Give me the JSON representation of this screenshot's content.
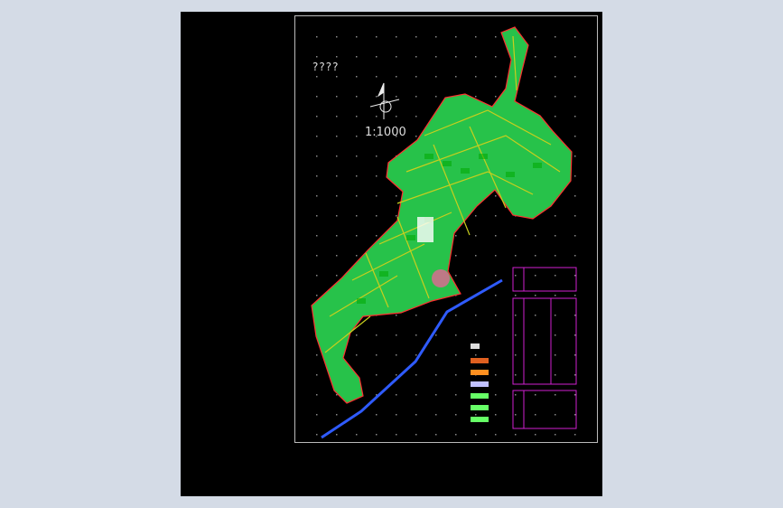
{
  "drawing": {
    "title": "????",
    "scale_label": "1:1000"
  },
  "colors": {
    "background": "#d4dbe6",
    "canvas": "#000000",
    "site": "#27c24a",
    "road": "#c8cf1e",
    "boundary": "#ff3030",
    "highway": "#2f5bff",
    "table_line": "#d020d0",
    "text": "#dddddd"
  },
  "icons": [
    "north-arrow-icon"
  ]
}
